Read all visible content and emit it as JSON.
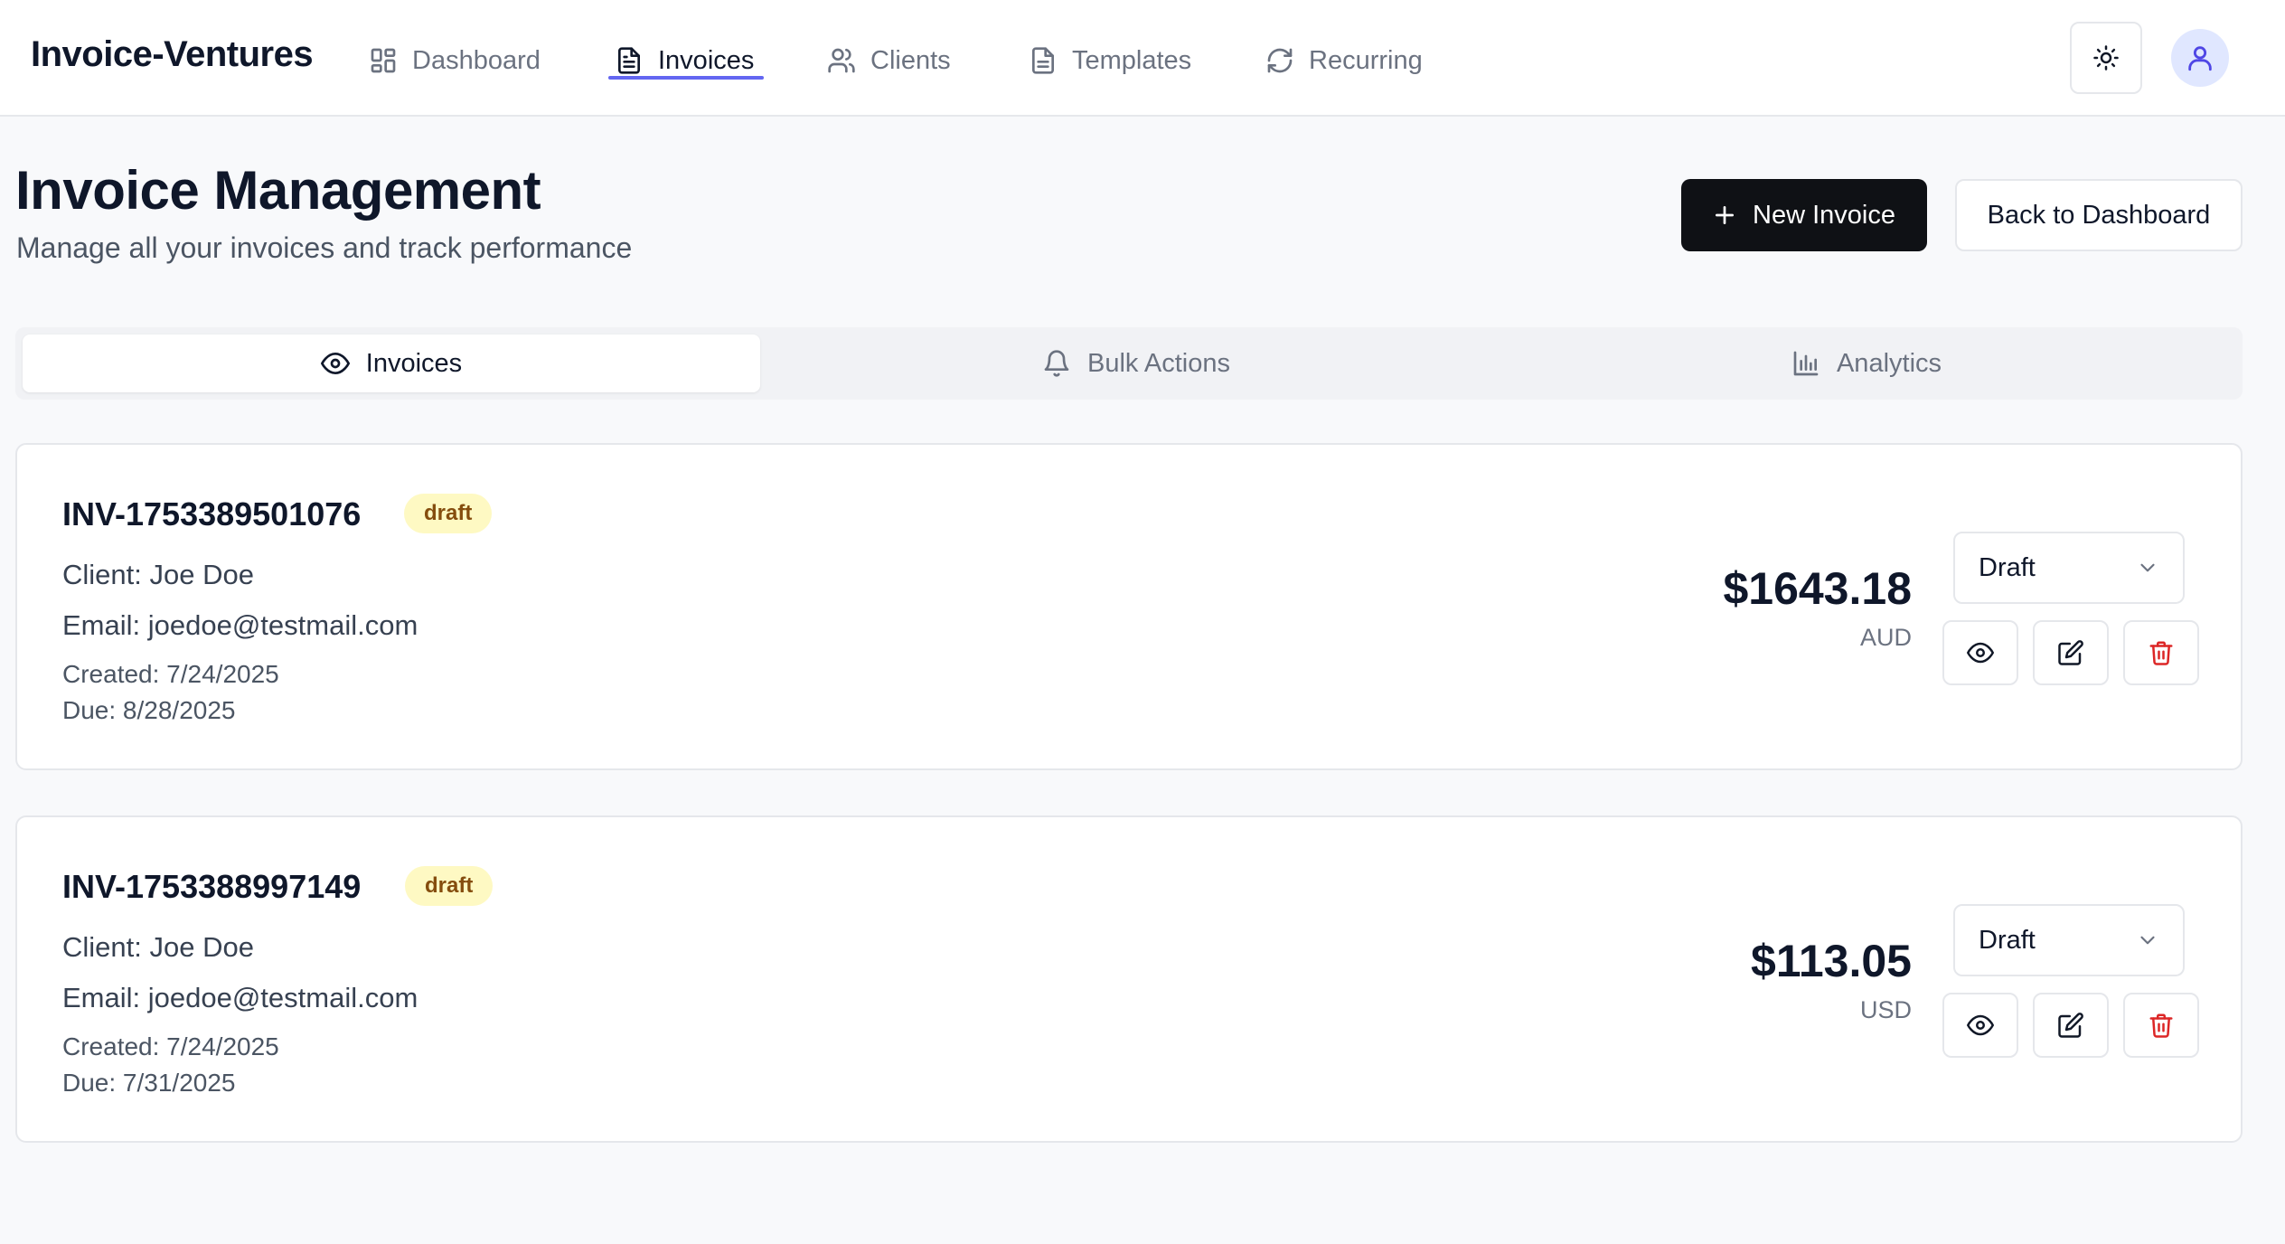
{
  "app": {
    "brand": "Invoice-Ventures"
  },
  "nav": {
    "items": [
      {
        "label": "Dashboard",
        "icon": "grid-icon"
      },
      {
        "label": "Invoices",
        "icon": "file-text-icon",
        "active": true
      },
      {
        "label": "Clients",
        "icon": "users-icon"
      },
      {
        "label": "Templates",
        "icon": "file-icon"
      },
      {
        "label": "Recurring",
        "icon": "refresh-icon"
      }
    ],
    "accent": "#6366f1"
  },
  "header": {
    "title": "Invoice Management",
    "subtitle": "Manage all your invoices and track performance",
    "new_invoice_label": "New Invoice",
    "back_label": "Back to Dashboard"
  },
  "tabs": [
    {
      "label": "Invoices",
      "icon": "eye-icon",
      "active": true
    },
    {
      "label": "Bulk Actions",
      "icon": "bell-icon"
    },
    {
      "label": "Analytics",
      "icon": "bar-chart-icon"
    }
  ],
  "invoices": [
    {
      "id": "INV-1753389501076",
      "badge": "draft",
      "client": "Client: Joe Doe",
      "email": "Email: joedoe@testmail.com",
      "created": "Created: 7/24/2025",
      "due": "Due: 8/28/2025",
      "amount": "$1643.18",
      "currency": "AUD",
      "status": "Draft"
    },
    {
      "id": "INV-1753388997149",
      "badge": "draft",
      "client": "Client: Joe Doe",
      "email": "Email: joedoe@testmail.com",
      "created": "Created: 7/24/2025",
      "due": "Due: 7/31/2025",
      "amount": "$113.05",
      "currency": "USD",
      "status": "Draft"
    }
  ],
  "colors": {
    "primary_button": "#0f1115",
    "badge_bg": "#fef9c3",
    "badge_text": "#854d0e",
    "delete": "#dc2626"
  }
}
